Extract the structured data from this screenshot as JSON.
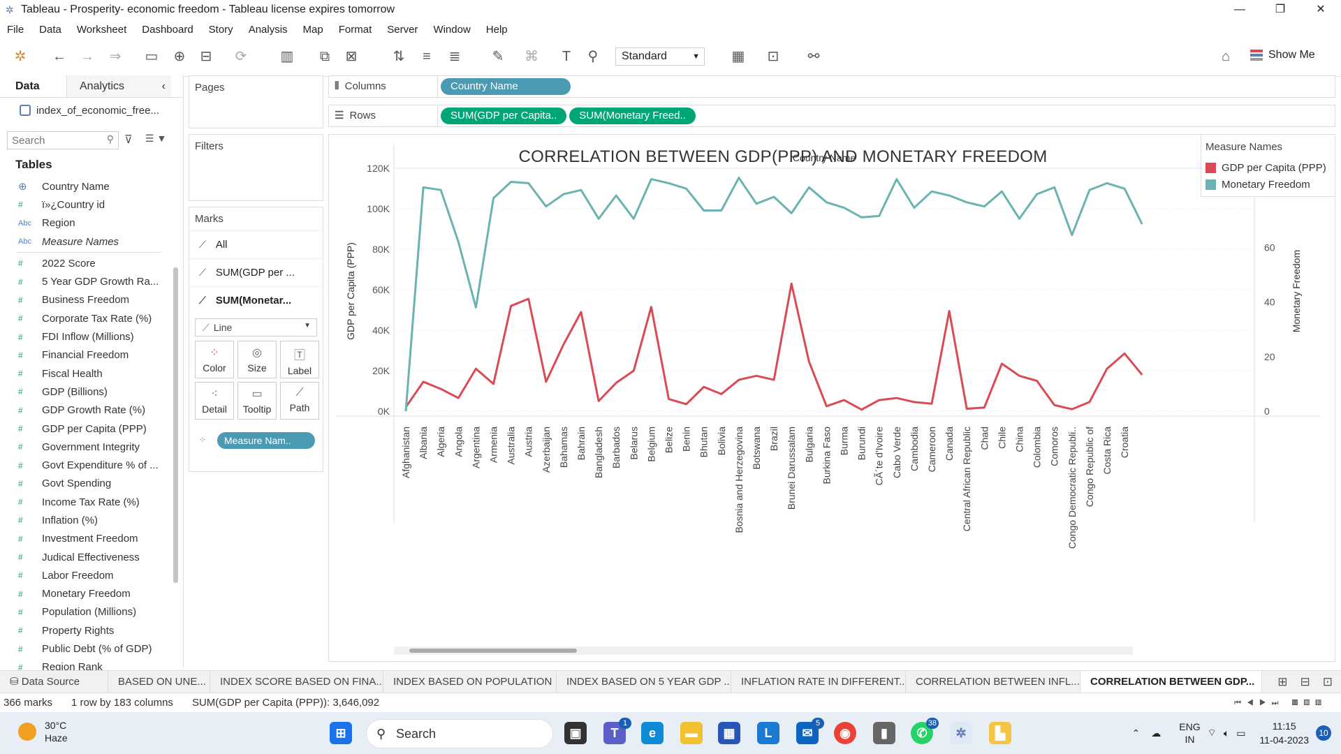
{
  "window": {
    "title": "Tableau - Prosperity- economic freedom - Tableau license expires tomorrow",
    "minimize": "—",
    "maximize": "❐",
    "close": "✕"
  },
  "menu": [
    "File",
    "Data",
    "Worksheet",
    "Dashboard",
    "Story",
    "Analysis",
    "Map",
    "Format",
    "Server",
    "Window",
    "Help"
  ],
  "toolbar": {
    "fit_select": "Standard",
    "show_me": "Show Me"
  },
  "data_pane": {
    "tab_data": "Data",
    "tab_analytics": "Analytics",
    "collapse": "‹",
    "source": "index_of_economic_free...",
    "search_placeholder": "Search",
    "tables_heading": "Tables",
    "fields": [
      {
        "icon": "globe",
        "label": "Country Name"
      },
      {
        "icon": "#",
        "label": "ï»¿Country id"
      },
      {
        "icon": "Abc",
        "label": "Region"
      },
      {
        "icon": "Abc",
        "label": "Measure Names",
        "italic": true
      },
      {
        "icon": "#",
        "label": "2022 Score"
      },
      {
        "icon": "#",
        "label": "5 Year GDP Growth Ra..."
      },
      {
        "icon": "#",
        "label": "Business Freedom"
      },
      {
        "icon": "#",
        "label": "Corporate Tax Rate (%)"
      },
      {
        "icon": "#",
        "label": "FDI Inflow (Millions)"
      },
      {
        "icon": "#",
        "label": "Financial Freedom"
      },
      {
        "icon": "#",
        "label": "Fiscal Health"
      },
      {
        "icon": "#",
        "label": "GDP (Billions)"
      },
      {
        "icon": "#",
        "label": "GDP Growth Rate (%)"
      },
      {
        "icon": "#",
        "label": "GDP per Capita (PPP)"
      },
      {
        "icon": "#",
        "label": "Government Integrity"
      },
      {
        "icon": "#",
        "label": "Govt Expenditure % of ..."
      },
      {
        "icon": "#",
        "label": "Govt Spending"
      },
      {
        "icon": "#",
        "label": "Income Tax Rate (%)"
      },
      {
        "icon": "#",
        "label": "Inflation (%)"
      },
      {
        "icon": "#",
        "label": "Investment Freedom"
      },
      {
        "icon": "#",
        "label": "Judical Effectiveness"
      },
      {
        "icon": "#",
        "label": "Labor Freedom"
      },
      {
        "icon": "#",
        "label": "Monetary Freedom"
      },
      {
        "icon": "#",
        "label": "Population (Millions)"
      },
      {
        "icon": "#",
        "label": "Property Rights"
      },
      {
        "icon": "#",
        "label": "Public Debt (% of GDP)"
      },
      {
        "icon": "#",
        "label": "Region Rank"
      }
    ]
  },
  "cards": {
    "pages": "Pages",
    "filters": "Filters",
    "marks": "Marks",
    "marks_rows": [
      "All",
      "SUM(GDP per ...",
      "SUM(Monetar..."
    ],
    "mark_type": "Line",
    "mark_buttons": [
      "Color",
      "Size",
      "Label",
      "Detail",
      "Tooltip",
      "Path"
    ],
    "color_pill": "Measure Nam.."
  },
  "shelves": {
    "columns_label": "Columns",
    "rows_label": "Rows",
    "columns_pill": "Country Name",
    "rows_pills": [
      "SUM(GDP per Capita..",
      "SUM(Monetary Freed.."
    ]
  },
  "legend": {
    "title": "Measure Names",
    "items": [
      {
        "label": "GDP per Capita (PPP)",
        "color": "#d94a55"
      },
      {
        "label": "Monetary Freedom",
        "color": "#6ab3b0"
      }
    ]
  },
  "chart_data": {
    "type": "line",
    "title": "CORRELATION BETWEEN GDP(PPP) AND MONETARY FREEDOM",
    "xlabel": "Country Name",
    "ylabel_left": "GDP per Capita (PPP)",
    "ylabel_right": "Monetary Freedom",
    "ylim_left": [
      0,
      120000
    ],
    "ylim_right": [
      0,
      90
    ],
    "yticks_left": [
      "0K",
      "20K",
      "40K",
      "60K",
      "80K",
      "100K",
      "120K"
    ],
    "yticks_right": [
      "0",
      "20",
      "40",
      "60",
      "80"
    ],
    "categories": [
      "Afghanistan",
      "Albania",
      "Algeria",
      "Angola",
      "Argentina",
      "Armenia",
      "Australia",
      "Austria",
      "Azerbaijan",
      "Bahamas",
      "Bahrain",
      "Bangladesh",
      "Barbados",
      "Belarus",
      "Belgium",
      "Belize",
      "Benin",
      "Bhutan",
      "Bolivia",
      "Bosnia and Herzegovina",
      "Botswana",
      "Brazil",
      "Brunei Darussalam",
      "Bulgaria",
      "Burkina Faso",
      "Burma",
      "Burundi",
      "CÃ´te d'Ivoire",
      "Cabo Verde",
      "Cambodia",
      "Cameroon",
      "Canada",
      "Central African Republic",
      "Chad",
      "Chile",
      "China",
      "Colombia",
      "Comoros",
      "Congo Democratic Republi..",
      "Congo Republic of",
      "Costa Rica",
      "Croatia"
    ],
    "series": [
      {
        "name": "GDP per Capita (PPP)",
        "color": "#d94a55",
        "axis": "left",
        "values": [
          2000,
          14500,
          11000,
          6500,
          21000,
          13500,
          52000,
          55500,
          14500,
          33000,
          49000,
          5000,
          14000,
          20000,
          51500,
          6000,
          3500,
          12000,
          8500,
          15500,
          17500,
          15500,
          63000,
          24500,
          2500,
          5500,
          800,
          5500,
          6500,
          4500,
          3700,
          49500,
          1200,
          1800,
          23500,
          17500,
          15000,
          3000,
          1000,
          4500,
          21000,
          28500,
          18000
        ]
      },
      {
        "name": "Monetary Freedom",
        "color": "#6ab3b0",
        "axis": "left_scaled",
        "values": [
          0,
          82,
          81,
          62,
          38,
          78,
          84,
          83.5,
          75,
          79.5,
          81,
          70.5,
          79,
          70.5,
          85,
          83.5,
          81.5,
          73.5,
          73.5,
          85.5,
          76,
          78.5,
          72.5,
          82,
          76.5,
          74.5,
          71,
          71.5,
          85,
          74.5,
          80.5,
          79,
          76.5,
          75,
          80.5,
          70.5,
          79.5,
          82,
          64.5,
          81,
          83.5,
          81.5,
          68.5
        ]
      }
    ]
  },
  "sheet_tabs": [
    "Data Source",
    "BASED ON UNE...",
    "INDEX SCORE BASED ON FINA...",
    "INDEX BASED ON POPULATION",
    "INDEX BASED ON 5 YEAR GDP ...",
    "INFLATION RATE IN DIFFERENT...",
    "CORRELATION BETWEEN INFL...",
    "CORRELATION BETWEEN GDP..."
  ],
  "status": {
    "marks": "366 marks",
    "dims": "1 row by 183 columns",
    "sum": "SUM(GDP per Capita (PPP)): 3,646,092"
  },
  "taskbar": {
    "temp": "30°C",
    "weather": "Haze",
    "search": "Search",
    "lang1": "ENG",
    "lang2": "IN",
    "time": "11:15",
    "date": "11-04-2023",
    "badge_teams": "1",
    "badge_mail": "5",
    "badge_whatsapp": "38",
    "notifications": "10"
  }
}
